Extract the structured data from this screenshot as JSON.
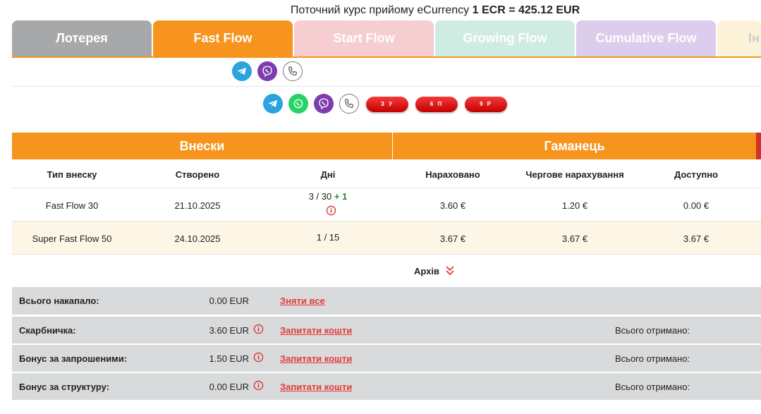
{
  "rate": {
    "prefix": "Поточний курс прийому eCurrency",
    "value": "1 ECR = 425.12 EUR"
  },
  "tabs": [
    {
      "label": "Лотерея",
      "bg": "#a7a8aa",
      "state": "inactive"
    },
    {
      "label": "Fast Flow",
      "bg": "#f7941d",
      "state": "active"
    },
    {
      "label": "Start Flow",
      "bg": "#f6cdd1",
      "state": "inactive"
    },
    {
      "label": "Growing Flow",
      "bg": "#cfece3",
      "state": "inactive"
    },
    {
      "label": "Cumulative Flow",
      "bg": "#dbcdeb",
      "state": "inactive"
    },
    {
      "label": "Ін",
      "bg": "#fdf3d8",
      "state": "inactive"
    }
  ],
  "contacts_row1": [
    "telegram-icon",
    "viber-icon",
    "phone-icon"
  ],
  "contacts_row2": [
    "telegram-icon",
    "whatsapp-icon",
    "viber-icon",
    "phone-icon"
  ],
  "pills": [
    "З У",
    "6 П",
    "9 Р"
  ],
  "deposits": {
    "title": "Внески",
    "columns": [
      "Тип внеску",
      "Створено",
      "Дні"
    ],
    "rows": [
      {
        "type": "Fast Flow 30",
        "created": "21.10.2025",
        "days": "3 / 30",
        "bonus": "+ 1"
      },
      {
        "type": "Super Fast Flow 50",
        "created": "24.10.2025",
        "days": "1 / 15",
        "bonus": ""
      }
    ]
  },
  "wallet": {
    "title": "Гаманець",
    "columns": [
      "Нараховано",
      "Чергове нарахування",
      "Доступно"
    ],
    "rows": [
      {
        "accrued": "3.60 €",
        "next": "1.20 €",
        "available": "0.00 €"
      },
      {
        "accrued": "3.67 €",
        "next": "3.67 €",
        "available": "3.67 €"
      }
    ]
  },
  "archive_label": "Архів",
  "summary": [
    {
      "label": "Всього накапало:",
      "value": "0.00 EUR",
      "link": "Зняти все",
      "received": ""
    },
    {
      "label": "Скарбничка:",
      "value": "3.60 EUR",
      "link": "Запитати кошти",
      "received": "Всього отримано:"
    },
    {
      "label": "Бонус за запрошеними:",
      "value": "1.50 EUR",
      "link": "Запитати кошти",
      "received": "Всього отримано:"
    },
    {
      "label": "Бонус за структуру:",
      "value": "0.00 EUR",
      "link": "Запитати кошти",
      "received": "Всього отримано:"
    }
  ],
  "colors": {
    "accent": "#f7941d",
    "alt_row": "#fdf5e6",
    "link": "#e53935",
    "summary_bg": "#d9dadc",
    "telegram": "#2aa3df",
    "viber": "#7d3daf",
    "whatsapp": "#25d366"
  }
}
